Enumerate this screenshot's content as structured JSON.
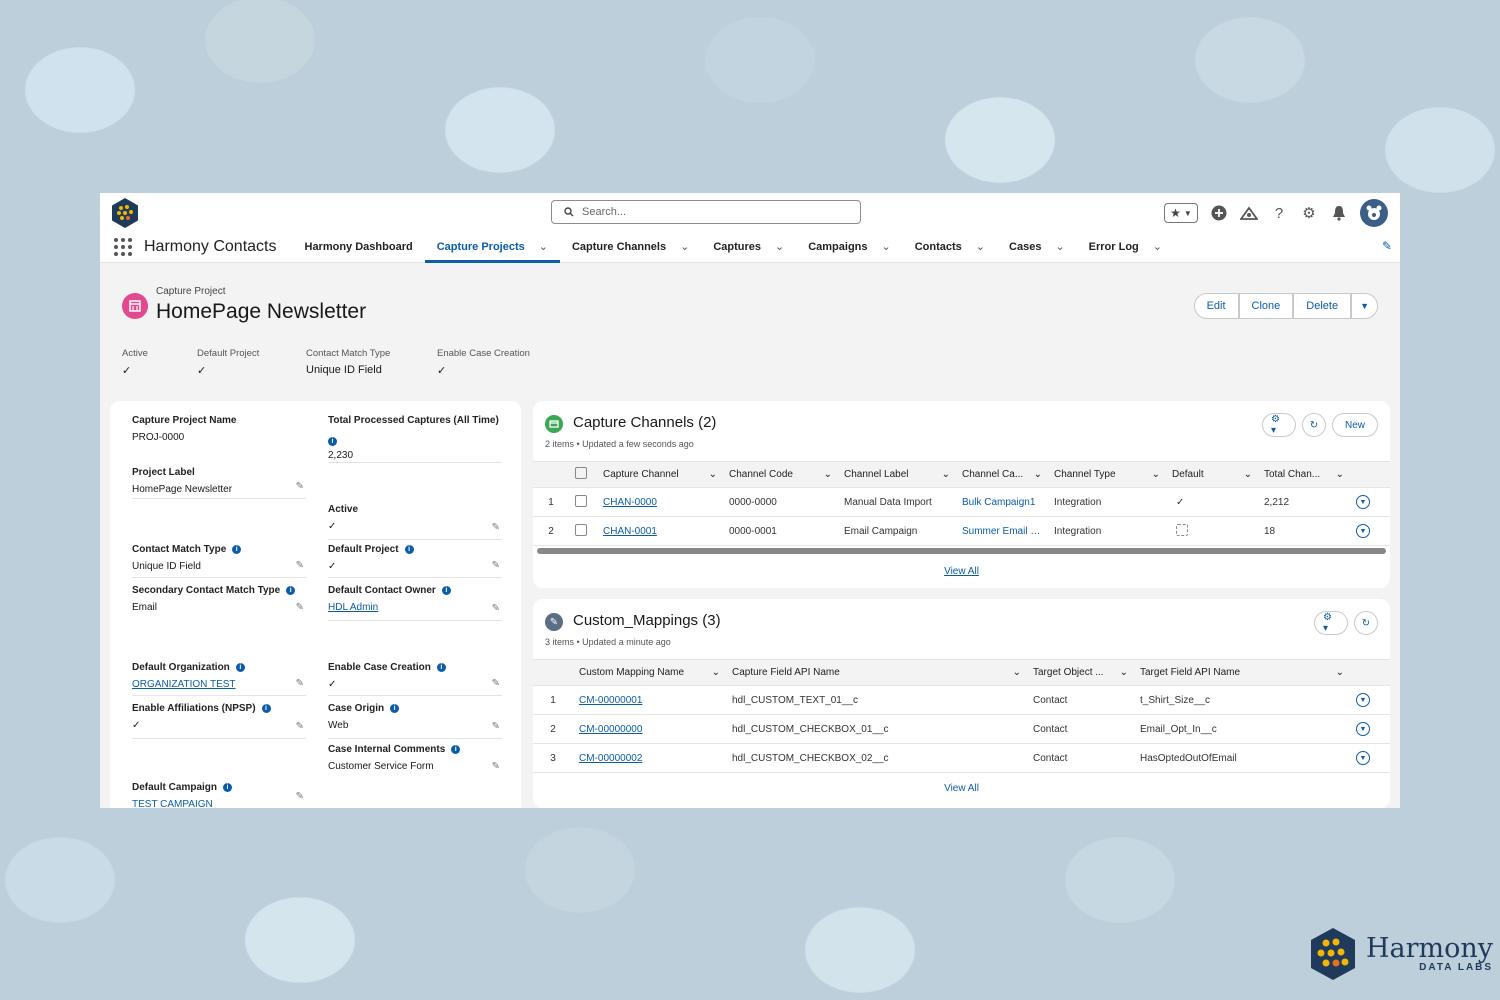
{
  "header": {
    "search_placeholder": "Search...",
    "app_name": "Harmony Contacts",
    "tabs": [
      {
        "label": "Harmony Dashboard"
      },
      {
        "label": "Capture Projects"
      },
      {
        "label": "Capture Channels"
      },
      {
        "label": "Captures"
      },
      {
        "label": "Campaigns"
      },
      {
        "label": "Contacts"
      },
      {
        "label": "Cases"
      },
      {
        "label": "Error Log"
      }
    ]
  },
  "record": {
    "type": "Capture Project",
    "title": "HomePage Newsletter",
    "actions": {
      "edit": "Edit",
      "clone": "Clone",
      "delete": "Delete"
    },
    "highlights": [
      {
        "label": "Active",
        "value": "✓"
      },
      {
        "label": "Default Project",
        "value": "✓"
      },
      {
        "label": "Contact Match Type",
        "value": "Unique ID Field"
      },
      {
        "label": "Enable Case Creation",
        "value": "✓"
      }
    ]
  },
  "details": {
    "capture_project_name": {
      "label": "Capture Project Name",
      "value": "PROJ-0000"
    },
    "total_processed": {
      "label": "Total Processed Captures (All Time)",
      "value": "2,230"
    },
    "project_label": {
      "label": "Project Label",
      "value": "HomePage Newsletter"
    },
    "active": {
      "label": "Active",
      "value": "✓"
    },
    "contact_match_type": {
      "label": "Contact Match Type",
      "value": "Unique ID Field"
    },
    "default_project": {
      "label": "Default Project",
      "value": "✓"
    },
    "secondary_match_type": {
      "label": "Secondary Contact Match Type",
      "value": "Email"
    },
    "default_owner": {
      "label": "Default Contact Owner",
      "value": "HDL Admin"
    },
    "default_org": {
      "label": "Default Organization",
      "value": "ORGANIZATION TEST"
    },
    "enable_case": {
      "label": "Enable Case Creation",
      "value": "✓"
    },
    "enable_affiliations": {
      "label": "Enable Affiliations (NPSP)",
      "value": "✓"
    },
    "case_origin": {
      "label": "Case Origin",
      "value": "Web"
    },
    "case_comments": {
      "label": "Case Internal Comments",
      "value": "Customer Service Form"
    },
    "default_campaign": {
      "label": "Default Campaign",
      "value": "TEST CAMPAIGN"
    }
  },
  "channels": {
    "title": "Capture Channels (2)",
    "subtitle": "2 items • Updated a few seconds ago",
    "new_label": "New",
    "columns": [
      "Capture Channel",
      "Channel Code",
      "Channel Label",
      "Channel Ca...",
      "Channel Type",
      "Default",
      "Total Chan..."
    ],
    "rows": [
      {
        "num": "1",
        "name": "CHAN-0000",
        "code": "0000-0000",
        "label": "Manual Data Import",
        "campaign": "Bulk Campaign1",
        "type": "Integration",
        "default": "✓",
        "total": "2,212"
      },
      {
        "num": "2",
        "name": "CHAN-0001",
        "code": "0000-0001",
        "label": "Email Campaign",
        "campaign": "Summer Email C...",
        "type": "Integration",
        "default": "",
        "total": "18"
      }
    ],
    "view_all": "View All"
  },
  "mappings": {
    "title": "Custom_Mappings (3)",
    "subtitle": "3 items • Updated a minute ago",
    "columns": [
      "Custom Mapping Name",
      "Capture Field API Name",
      "Target Object ...",
      "Target Field API Name"
    ],
    "rows": [
      {
        "num": "1",
        "name": "CM-00000001",
        "api": "hdl_CUSTOM_TEXT_01__c",
        "object": "Contact",
        "target": "t_Shirt_Size__c"
      },
      {
        "num": "2",
        "name": "CM-00000000",
        "api": "hdl_CUSTOM_CHECKBOX_01__c",
        "object": "Contact",
        "target": "Email_Opt_In__c"
      },
      {
        "num": "3",
        "name": "CM-00000002",
        "api": "hdl_CUSTOM_CHECKBOX_02__c",
        "object": "Contact",
        "target": "HasOptedOutOfEmail"
      }
    ],
    "view_all": "View All"
  },
  "brand": {
    "name": "Harmony",
    "sub": "DATA LABS"
  },
  "colors": {
    "brand_blue": "#0b5cab",
    "record_icon": "#e3498f",
    "channels_icon": "#3ba755",
    "mappings_icon": "#5a6e85"
  }
}
